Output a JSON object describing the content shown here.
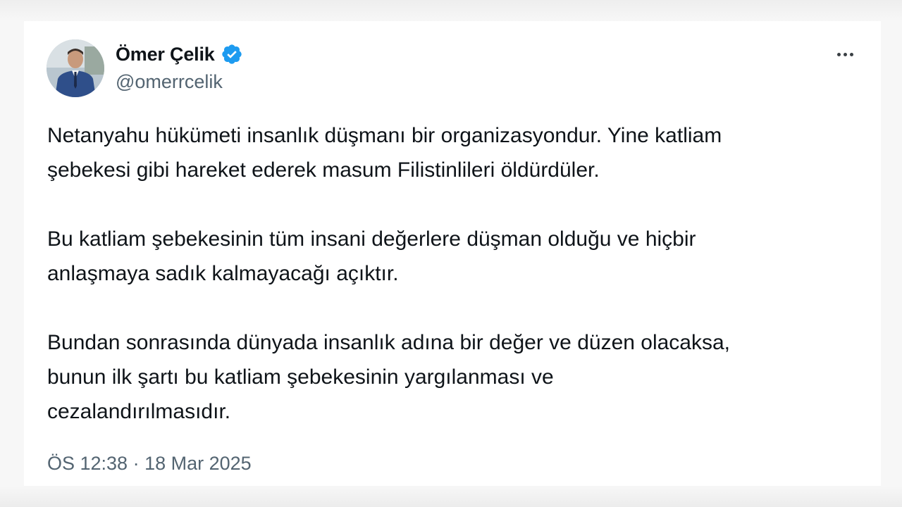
{
  "author": {
    "display_name": "Ömer Çelik",
    "handle": "@omerrcelik",
    "verified": true,
    "verified_badge_color": "#1d9bf0",
    "avatar_icon": "profile-photo"
  },
  "menu": {
    "icon": "more-horizontal-icon"
  },
  "tweet": {
    "paragraphs": [
      "Netanyahu hükümeti insanlık düşmanı bir organizasyondur. Yine katliam\nşebekesi gibi hareket ederek masum Filistinlileri öldürdüler.",
      "Bu katliam şebekesinin tüm insani değerlere düşman olduğu ve hiçbir\nanlaşmaya sadık kalmayacağı açıktır.",
      "Bundan sonrasında dünyada insanlık adına bir değer ve düzen olacaksa,\nbunun ilk şartı bu katliam şebekesinin yargılanması ve\ncezalandırılmasıdır."
    ],
    "timestamp": "ÖS 12:38 · 18 Mar 2025"
  },
  "colors": {
    "text_primary": "#0f1419",
    "text_secondary": "#536471",
    "card_background": "#ffffff"
  }
}
